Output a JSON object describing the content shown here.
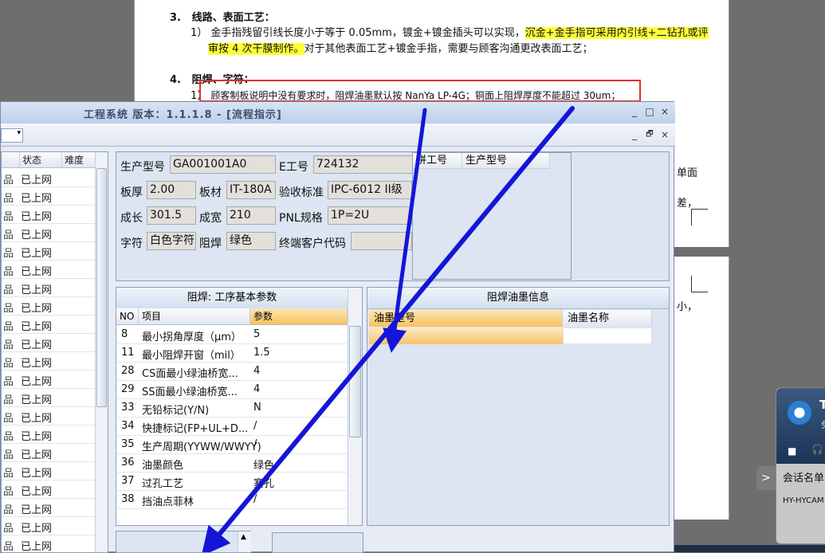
{
  "document": {
    "sec3_num": "3.",
    "sec3_title": "线路、表面工艺：",
    "sec3_item_num": "1）",
    "sec3_line1": "金手指残留引线长度小于等于 0.05mm，镀金+镀金插头可以实现，",
    "sec3_line1_highlight": "沉金+金手指可采用内引线+二钻孔或评",
    "sec3_line2_highlight": "审按 4 次干膜制作。",
    "sec3_line2_rest": "对于其他表面工艺+镀金手指，需要与顾客沟通更改表面工艺；",
    "sec4_num": "4.",
    "sec4_title": "阻焊、字符：",
    "sec4_item_num": "1）",
    "sec4_line1": "顾客制板说明中没有要求时，阻焊油墨默认按 NanYa LP-4G；铜面上阻焊厚度不能超过 30um；",
    "right_frag1": "单面",
    "right_frag2": "差，",
    "right_frag3": "小，"
  },
  "app": {
    "title": "工程系统 版本：1.1.1.8 - [流程指示]",
    "combo_arrow": "▾",
    "outer_controls": [
      "_",
      "□",
      "×"
    ],
    "inner_controls": [
      "_",
      "🗗",
      "×"
    ]
  },
  "left_grid": {
    "headers": [
      "状态",
      "难度"
    ],
    "row_lead": "品",
    "rows": [
      "已上网",
      "已上网",
      "已上网",
      "已上网",
      "已上网",
      "已上网",
      "已上网",
      "已上网",
      "已上网",
      "已上网",
      "已上网",
      "已上网",
      "已上网",
      "已上网",
      "已上网",
      "已上网",
      "已上网",
      "已上网",
      "已上网",
      "已上网",
      "已上网",
      "已上网"
    ]
  },
  "info": {
    "model_label": "生产型号",
    "model_value": "GA001001A0",
    "eno_label": "E工号",
    "eno_value": "724132",
    "thickness_label": "板厚",
    "thickness_value": "2.00",
    "material_label": "板材",
    "material_value": "IT-180A",
    "standard_label": "验收标准",
    "standard_value": "IPC-6012 II级",
    "length_label": "成长",
    "length_value": "301.5",
    "width_label": "成宽",
    "width_value": "210",
    "pnl_label": "PNL规格",
    "pnl_value": "1P=2U",
    "char_label": "字符",
    "char_value": "白色字符",
    "mask_label": "阻焊",
    "mask_value": "绿色",
    "customer_label": "终端客户代码",
    "customer_value": "",
    "pin_headers": [
      "拼工号",
      "生产型号"
    ]
  },
  "params": {
    "title": "阻焊: 工序基本参数",
    "headers": [
      "NO",
      "项目",
      "参数"
    ],
    "rows": [
      {
        "no": "8",
        "item": "最小拐角厚度（μm）",
        "value": "5"
      },
      {
        "no": "11",
        "item": "最小阻焊开窗（mil）",
        "value": "1.5"
      },
      {
        "no": "28",
        "item": "CS面最小绿油桥宽...",
        "value": "4"
      },
      {
        "no": "29",
        "item": "SS面最小绿油桥宽...",
        "value": "4"
      },
      {
        "no": "33",
        "item": "无铅标记(Y/N)",
        "value": "N"
      },
      {
        "no": "34",
        "item": "快捷标记(FP+UL+D...",
        "value": "/"
      },
      {
        "no": "35",
        "item": "生产周期(YYWW/WWYY)",
        "value": "/"
      },
      {
        "no": "36",
        "item": "油墨颜色",
        "value": "绿色"
      },
      {
        "no": "37",
        "item": "过孔工艺",
        "value": "塞孔"
      },
      {
        "no": "38",
        "item": "挡油点菲林",
        "value": "/"
      }
    ]
  },
  "ink": {
    "title": "阻焊油墨信息",
    "headers": [
      "油墨型号",
      "油墨名称"
    ]
  },
  "teamviewer": {
    "letter": "T",
    "sub": "免",
    "session": "会话名单",
    "host": "HY-HYCAM",
    "arrow": ">"
  },
  "colors": {
    "annotation_red": "#e0302a",
    "arrow_blue": "#1515d8",
    "highlight_yellow": "#ffff38",
    "selected_orange": "#f7c25c"
  }
}
